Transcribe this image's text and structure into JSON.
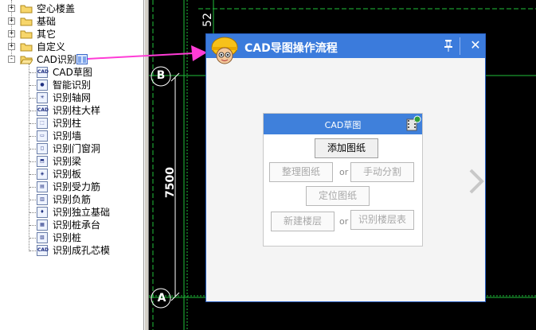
{
  "tree": {
    "folders": [
      {
        "label": "空心楼盖",
        "expander": "+"
      },
      {
        "label": "基础",
        "expander": "+"
      },
      {
        "label": "其它",
        "expander": "+"
      },
      {
        "label": "自定义",
        "expander": "+"
      },
      {
        "label": "CAD识别",
        "expander": "-"
      }
    ],
    "items": [
      {
        "label": "CAD草图",
        "icon": "cad-sketch-icon"
      },
      {
        "label": "智能识别",
        "icon": "smart-recognize-icon"
      },
      {
        "label": "识别轴网",
        "icon": "axis-grid-icon"
      },
      {
        "label": "识别柱大样",
        "icon": "column-detail-icon"
      },
      {
        "label": "识别柱",
        "icon": "column-icon"
      },
      {
        "label": "识别墙",
        "icon": "wall-icon"
      },
      {
        "label": "识别门窗洞",
        "icon": "door-window-icon"
      },
      {
        "label": "识别梁",
        "icon": "beam-icon"
      },
      {
        "label": "识别板",
        "icon": "slab-icon"
      },
      {
        "label": "识别受力筋",
        "icon": "stress-rebar-icon"
      },
      {
        "label": "识别负筋",
        "icon": "negative-rebar-icon"
      },
      {
        "label": "识别独立基础",
        "icon": "isolated-footing-icon"
      },
      {
        "label": "识别桩承台",
        "icon": "pile-cap-icon"
      },
      {
        "label": "识别桩",
        "icon": "pile-icon"
      },
      {
        "label": "识别成孔芯模",
        "icon": "hole-core-icon"
      }
    ]
  },
  "canvas": {
    "axis_b": "B",
    "axis_a": "A",
    "dim_top": "52",
    "dim_left": "7500"
  },
  "dialog": {
    "title": "CAD导图操作流程",
    "pin": "pin-icon",
    "close": "✕",
    "card": {
      "title": "CAD草图",
      "add_drawing": "添加图纸",
      "arrange_drawing": "整理图纸",
      "or1": "or",
      "manual_split": "手动分割",
      "locate_drawing": "定位图纸",
      "new_floor": "新建楼层",
      "or2": "or",
      "recognize_floor_table": "识别楼层表"
    }
  },
  "colors": {
    "title_bar": "#3b7bdc",
    "grid_green": "#1fbf3a",
    "arrow_magenta": "#ff3cd6"
  }
}
